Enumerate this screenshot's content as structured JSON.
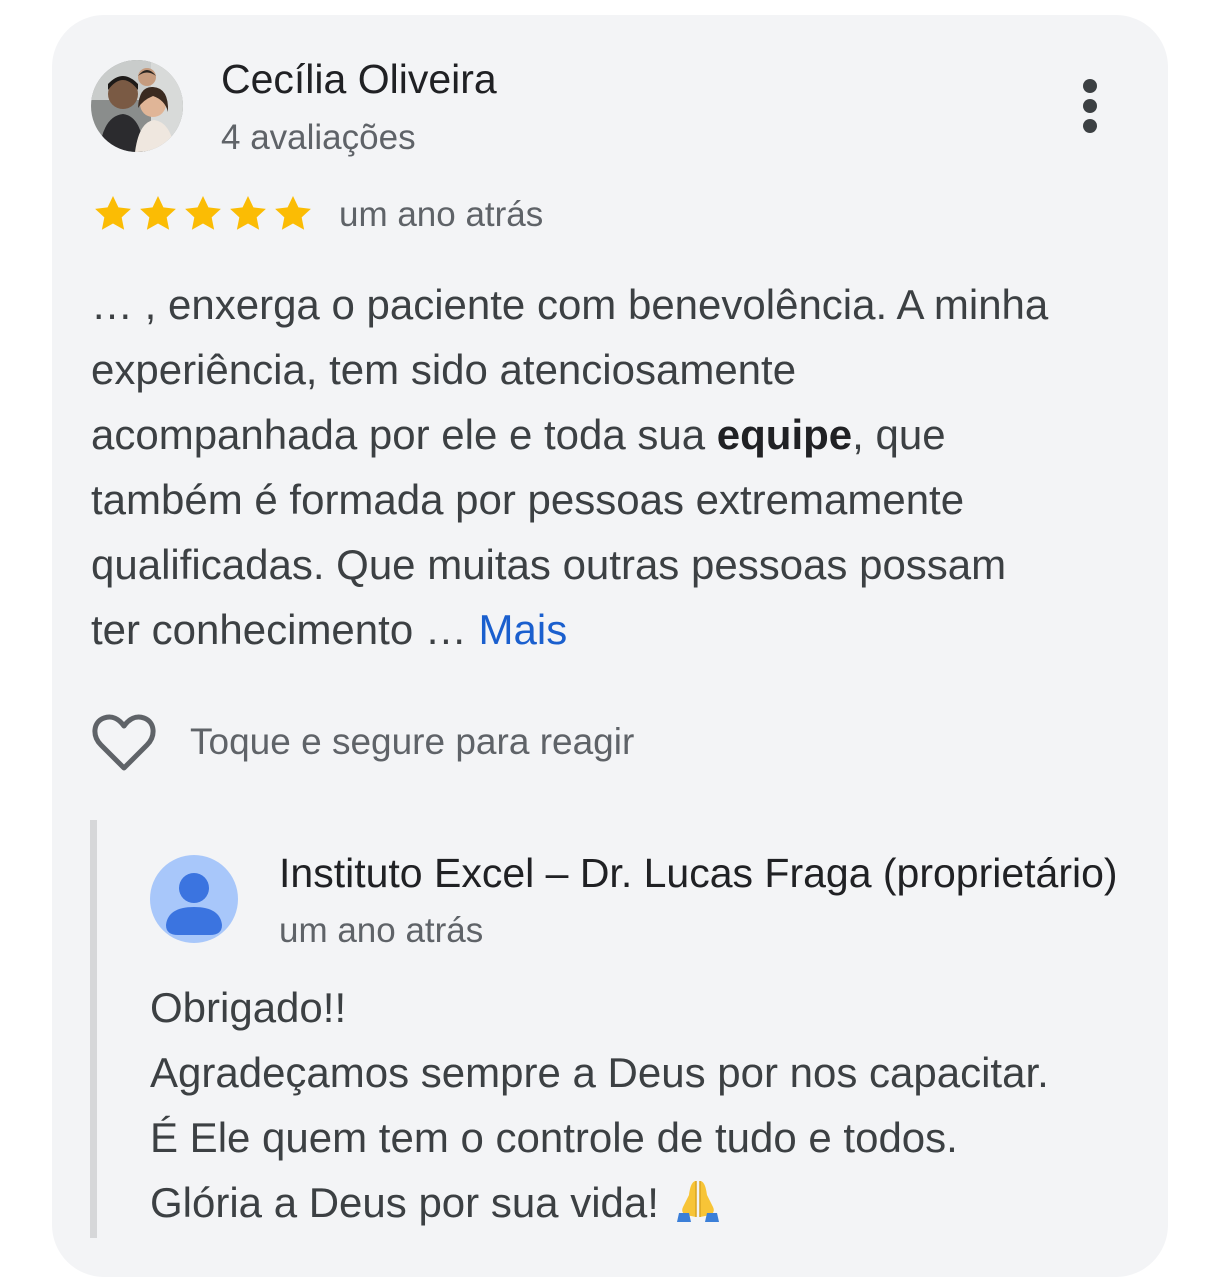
{
  "review": {
    "reviewer_name": "Cecília Oliveira",
    "review_count": "4 avaliações",
    "rating": 5,
    "rating_max": 5,
    "time": "um ano atrás",
    "text": {
      "line1": "… , enxerga o paciente com benevolência. A minha",
      "line2": "experiência, tem sido atenciosamente",
      "line3_before": "acompanhada por ele e toda sua ",
      "line3_bold": "equipe",
      "line3_after": ", que",
      "line4": "também é formada por pessoas extremamente",
      "line5": "qualificadas. Que muitas outras pessoas possam",
      "line6": "ter conhecimento … "
    },
    "more_label": "Mais",
    "react_label": "Toque e segure para reagir"
  },
  "reply": {
    "owner_name": "Instituto Excel – Dr. Lucas Fraga (proprietário)",
    "time": "um ano atrás",
    "lines": [
      "Obrigado!!",
      "Agradeçamos sempre a Deus por nos capacitar.",
      "É Ele quem tem o controle de tudo e todos.",
      "Glória a Deus por sua vida! "
    ]
  },
  "icons": {
    "menu": "more-vertical-icon",
    "star": "star-icon",
    "react": "heart-outline-icon",
    "owner": "account-icon",
    "emoji": "folded-hands-emoji-icon"
  },
  "colors": {
    "card_background": "#f3f4f6",
    "star": "#fbbc04",
    "link": "#1a5fce",
    "owner_avatar_bg": "#a8c7fa",
    "owner_avatar_fg": "#3b74e0"
  }
}
